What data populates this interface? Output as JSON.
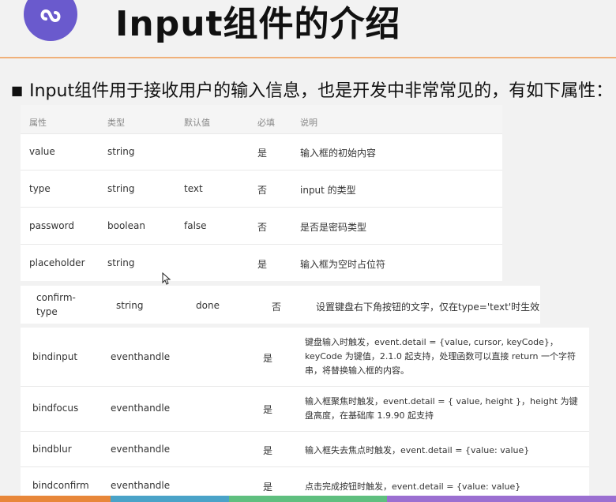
{
  "slide": {
    "title": "Input组件的介绍",
    "intro_bullet": "■",
    "intro": "Input组件用于接收用户的输入信息，也是开发中非常常见的，有如下属性："
  },
  "table": {
    "headers": {
      "attr": "属性",
      "type": "类型",
      "default": "默认值",
      "required": "必填",
      "desc": "说明"
    },
    "rows": [
      {
        "attr": "value",
        "type": "string",
        "default": "",
        "required": "是",
        "desc": "输入框的初始内容"
      },
      {
        "attr": "type",
        "type": "string",
        "default": "text",
        "required": "否",
        "desc": "input 的类型"
      },
      {
        "attr": "password",
        "type": "boolean",
        "default": "false",
        "required": "否",
        "desc": "是否是密码类型"
      },
      {
        "attr": "placeholder",
        "type": "string",
        "default": "",
        "required": "是",
        "desc": "输入框为空时占位符"
      },
      {
        "attr": "confirm-type",
        "type": "string",
        "default": "done",
        "required": "否",
        "desc": "设置键盘右下角按钮的文字，仅在type='text'时生效"
      },
      {
        "attr": "bindinput",
        "type": "eventhandle",
        "default": "",
        "required": "是",
        "desc": "键盘输入时触发，event.detail = {value, cursor, keyCode}，keyCode 为键值，2.1.0 起支持，处理函数可以直接 return 一个字符串，将替换输入框的内容。"
      },
      {
        "attr": "bindfocus",
        "type": "eventhandle",
        "default": "",
        "required": "是",
        "desc": "输入框聚焦时触发，event.detail = { value, height }，height 为键盘高度，在基础库 1.9.90 起支持"
      },
      {
        "attr": "bindblur",
        "type": "eventhandle",
        "default": "",
        "required": "是",
        "desc": "输入框失去焦点时触发，event.detail = {value: value}"
      },
      {
        "attr": "bindconfirm",
        "type": "eventhandle",
        "default": "",
        "required": "是",
        "desc": "点击完成按钮时触发，event.detail = {value: value}"
      }
    ]
  },
  "colors": {
    "logo": "#6a5acd",
    "divider": "#f0b07a",
    "bottom_strip": [
      "#e8873a",
      "#4aa3c8",
      "#5fbf7f",
      "#9b6fd1"
    ]
  },
  "icons": {
    "logo": "link-icon",
    "cursor": "mouse-pointer-icon"
  }
}
